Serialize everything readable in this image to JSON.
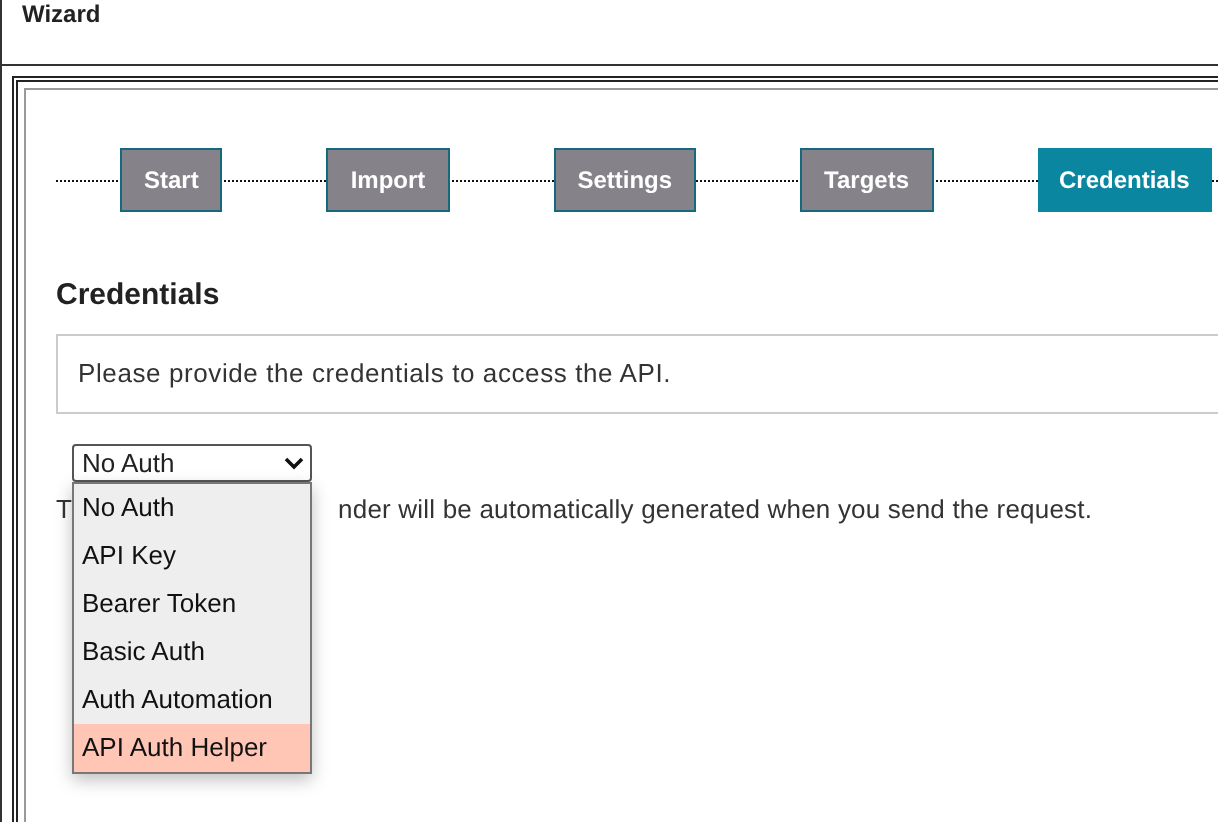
{
  "window": {
    "title": "Wizard"
  },
  "steps": [
    {
      "label": "Start",
      "selected": false
    },
    {
      "label": "Import",
      "selected": false
    },
    {
      "label": "Settings",
      "selected": false
    },
    {
      "label": "Targets",
      "selected": false
    },
    {
      "label": "Credentials",
      "selected": true
    }
  ],
  "section": {
    "heading": "Credentials",
    "info": "Please provide the credentials to access the API.",
    "auth_select": {
      "value": "No Auth",
      "expanded": true,
      "options": [
        {
          "label": "No Auth",
          "highlighted": false
        },
        {
          "label": "API Key",
          "highlighted": false
        },
        {
          "label": "Bearer Token",
          "highlighted": false
        },
        {
          "label": "Basic Auth",
          "highlighted": false
        },
        {
          "label": "Auth Automation",
          "highlighted": false
        },
        {
          "label": "API Auth Helper",
          "highlighted": true
        }
      ]
    },
    "hint_visible_parts": [
      "T",
      "nder will be automatically generated when you send the request."
    ]
  }
}
